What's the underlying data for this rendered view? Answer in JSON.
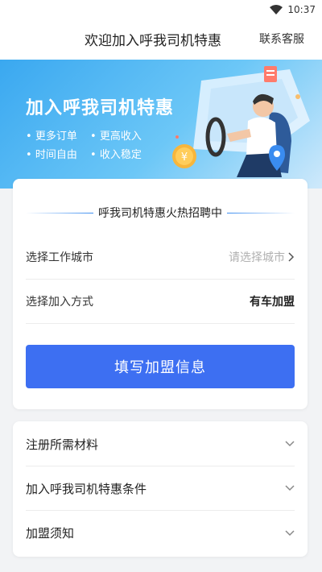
{
  "status_bar": {
    "time": "10:37"
  },
  "header": {
    "title": "欢迎加入呼我司机特惠",
    "service_label": "联系客服"
  },
  "banner": {
    "headline": "加入呼我司机特惠",
    "perks": [
      "更多订单",
      "更高收入",
      "时间自由",
      "收入稳定"
    ],
    "coin_symbol": "¥"
  },
  "recruit": {
    "title": "呼我司机特惠火热招聘中",
    "city_label": "选择工作城市",
    "city_placeholder": "请选择城市",
    "method_label": "选择加入方式",
    "method_value": "有车加盟",
    "submit_label": "填写加盟信息"
  },
  "faq": {
    "items": [
      "注册所需材料",
      "加入呼我司机特惠条件",
      "加盟须知"
    ]
  },
  "colors": {
    "primary": "#3d6ff2",
    "banner_start": "#3aa8f0",
    "accent_line": "#3a8cf0"
  }
}
